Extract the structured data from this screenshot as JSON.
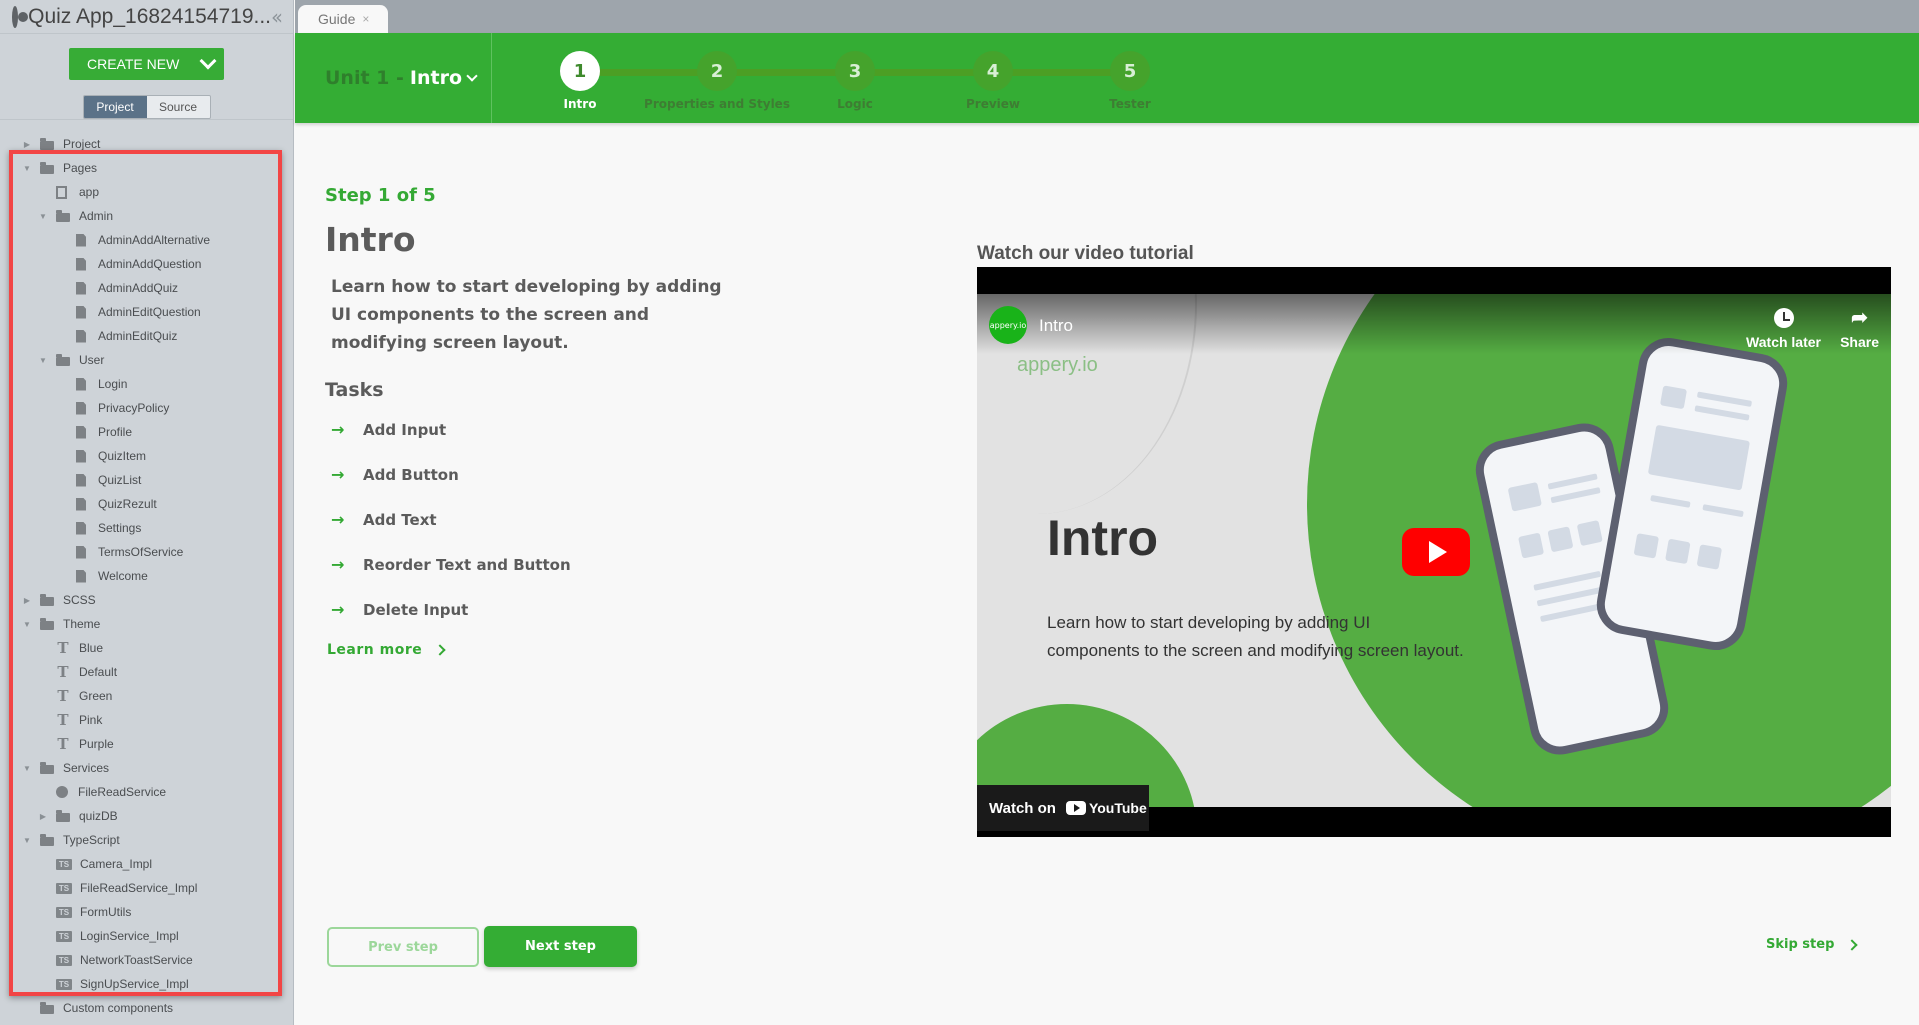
{
  "sidebar": {
    "app_title": "Quiz App_16824154719...",
    "create_new_label": "CREATE NEW",
    "view_toggle": {
      "project_label": "Project",
      "source_label": "Source",
      "active": "Project"
    },
    "tree": [
      {
        "label": "Project",
        "icon": "folder",
        "level": 0,
        "toggle": "collapsed"
      },
      {
        "label": "Pages",
        "icon": "folder",
        "level": 0,
        "toggle": "expanded"
      },
      {
        "label": "app",
        "icon": "app-page",
        "level": 1,
        "toggle": "none"
      },
      {
        "label": "Admin",
        "icon": "folder",
        "level": 1,
        "toggle": "expanded"
      },
      {
        "label": "AdminAddAlternative",
        "icon": "page",
        "level": 2,
        "toggle": "none"
      },
      {
        "label": "AdminAddQuestion",
        "icon": "page",
        "level": 2,
        "toggle": "none"
      },
      {
        "label": "AdminAddQuiz",
        "icon": "page",
        "level": 2,
        "toggle": "none"
      },
      {
        "label": "AdminEditQuestion",
        "icon": "page",
        "level": 2,
        "toggle": "none"
      },
      {
        "label": "AdminEditQuiz",
        "icon": "page",
        "level": 2,
        "toggle": "none"
      },
      {
        "label": "User",
        "icon": "folder",
        "level": 1,
        "toggle": "expanded"
      },
      {
        "label": "Login",
        "icon": "page",
        "level": 2,
        "toggle": "none"
      },
      {
        "label": "PrivacyPolicy",
        "icon": "page",
        "level": 2,
        "toggle": "none"
      },
      {
        "label": "Profile",
        "icon": "page",
        "level": 2,
        "toggle": "none"
      },
      {
        "label": "QuizItem",
        "icon": "page",
        "level": 2,
        "toggle": "none"
      },
      {
        "label": "QuizList",
        "icon": "page",
        "level": 2,
        "toggle": "none"
      },
      {
        "label": "QuizRezult",
        "icon": "page",
        "level": 2,
        "toggle": "none"
      },
      {
        "label": "Settings",
        "icon": "page",
        "level": 2,
        "toggle": "none"
      },
      {
        "label": "TermsOfService",
        "icon": "page",
        "level": 2,
        "toggle": "none"
      },
      {
        "label": "Welcome",
        "icon": "page",
        "level": 2,
        "toggle": "none"
      },
      {
        "label": "SCSS",
        "icon": "folder",
        "level": 0,
        "toggle": "collapsed"
      },
      {
        "label": "Theme",
        "icon": "folder",
        "level": 0,
        "toggle": "expanded"
      },
      {
        "label": "Blue",
        "icon": "theme",
        "level": 1,
        "toggle": "none"
      },
      {
        "label": "Default",
        "icon": "theme",
        "level": 1,
        "toggle": "none"
      },
      {
        "label": "Green",
        "icon": "theme",
        "level": 1,
        "toggle": "none"
      },
      {
        "label": "Pink",
        "icon": "theme",
        "level": 1,
        "toggle": "none"
      },
      {
        "label": "Purple",
        "icon": "theme",
        "level": 1,
        "toggle": "none"
      },
      {
        "label": "Services",
        "icon": "folder",
        "level": 0,
        "toggle": "expanded"
      },
      {
        "label": "FileReadService",
        "icon": "gear",
        "level": 1,
        "toggle": "none"
      },
      {
        "label": "quizDB",
        "icon": "folder",
        "level": 1,
        "toggle": "collapsed"
      },
      {
        "label": "TypeScript",
        "icon": "folder",
        "level": 0,
        "toggle": "expanded"
      },
      {
        "label": "Camera_Impl",
        "icon": "ts",
        "level": 1,
        "toggle": "none"
      },
      {
        "label": "FileReadService_Impl",
        "icon": "ts",
        "level": 1,
        "toggle": "none"
      },
      {
        "label": "FormUtils",
        "icon": "ts",
        "level": 1,
        "toggle": "none"
      },
      {
        "label": "LoginService_Impl",
        "icon": "ts",
        "level": 1,
        "toggle": "none"
      },
      {
        "label": "NetworkToastService",
        "icon": "ts",
        "level": 1,
        "toggle": "none"
      },
      {
        "label": "SignUpService_Impl",
        "icon": "ts",
        "level": 1,
        "toggle": "none"
      },
      {
        "label": "Custom components",
        "icon": "folder",
        "level": 0,
        "toggle": "none"
      }
    ]
  },
  "tabs": [
    {
      "label": "Guide",
      "close": "×",
      "active": true
    }
  ],
  "header": {
    "unit_prefix": "Unit 1 -",
    "unit_name": "Intro",
    "steps": [
      {
        "number": "1",
        "label": "Intro",
        "active": true
      },
      {
        "number": "2",
        "label": "Properties and Styles",
        "active": false
      },
      {
        "number": "3",
        "label": "Logic",
        "active": false
      },
      {
        "number": "4",
        "label": "Preview",
        "active": false
      },
      {
        "number": "5",
        "label": "Tester",
        "active": false
      }
    ]
  },
  "content": {
    "step_count": "Step 1 of 5",
    "title": "Intro",
    "description": "Learn how to start developing by adding UI components to the screen and modifying screen layout.",
    "tasks_heading": "Tasks",
    "tasks": [
      "Add Input",
      "Add Button",
      "Add Text",
      "Reorder Text and Button",
      "Delete Input"
    ],
    "learn_more": "Learn more"
  },
  "video": {
    "heading": "Watch our video tutorial",
    "title": "Intro",
    "channel_badge": "appery.io",
    "watch_later": "Watch later",
    "share": "Share",
    "brand": "appery.io",
    "frame_title": "Intro",
    "frame_desc": "Learn how to start developing by adding UI components to the screen and modifying screen layout.",
    "watch_on": "Watch on",
    "youtube": "YouTube"
  },
  "footer": {
    "prev_label": "Prev step",
    "next_label": "Next step",
    "skip_label": "Skip step"
  },
  "colors": {
    "accent_green": "#34ad34",
    "highlight_red": "#f24545",
    "sidebar_bg": "#ced3d8"
  }
}
